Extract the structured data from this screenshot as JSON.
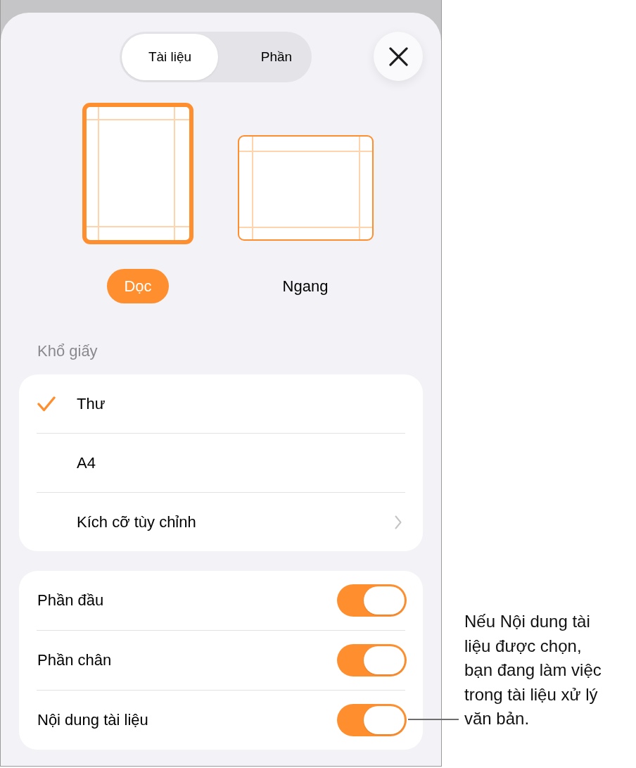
{
  "segments": [
    {
      "label": "Tài liệu",
      "selected": true
    },
    {
      "label": "Phần",
      "selected": false
    }
  ],
  "orientations": [
    {
      "kind": "portrait",
      "label": "Dọc",
      "selected": true
    },
    {
      "kind": "landscape",
      "label": "Ngang",
      "selected": false
    }
  ],
  "paper_size": {
    "heading": "Khổ giấy",
    "options": [
      {
        "kind": "check",
        "label": "Thư",
        "selected": true
      },
      {
        "kind": "check",
        "label": "A4",
        "selected": false
      },
      {
        "kind": "disclosure",
        "label": "Kích cỡ tùy chỉnh",
        "selected": false
      }
    ]
  },
  "toggles": [
    {
      "label": "Phần đầu",
      "on": true
    },
    {
      "label": "Phần chân",
      "on": true
    },
    {
      "label": "Nội dung tài liệu",
      "on": true
    }
  ],
  "callout": {
    "text": "Nếu Nội dung tài liệu được chọn, bạn đang làm việc trong tài liệu xử lý văn bản."
  }
}
